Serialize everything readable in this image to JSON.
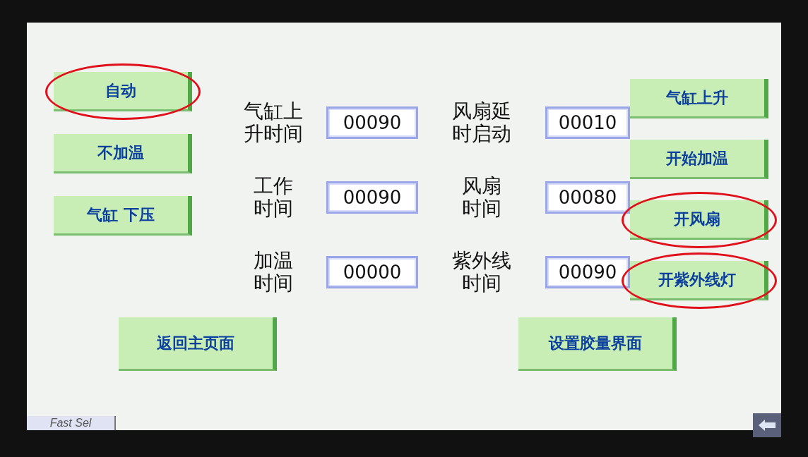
{
  "left_buttons": [
    {
      "label": "自动",
      "circled": true
    },
    {
      "label": "不加温",
      "circled": false
    },
    {
      "label": "气缸 下压",
      "circled": false
    }
  ],
  "fields": [
    {
      "label": "气缸上升时间",
      "value": "00090"
    },
    {
      "label": "风扇延时启动",
      "value": "00010"
    },
    {
      "label": "工作时间",
      "value": "00090"
    },
    {
      "label": "风扇时间",
      "value": "00080"
    },
    {
      "label": "加温时间",
      "value": "00000"
    },
    {
      "label": "紫外线时间",
      "value": "00090"
    }
  ],
  "right_buttons": [
    {
      "label": "气缸上升",
      "circled": false
    },
    {
      "label": "开始加温",
      "circled": false
    },
    {
      "label": "开风扇",
      "circled": true
    },
    {
      "label": "开紫外线灯",
      "circled": true
    }
  ],
  "bottom_buttons": [
    {
      "label": "返回主页面",
      "circled": false
    },
    {
      "label": "设置胶量界面",
      "circled": false
    }
  ],
  "fast_sel": "Fast Sel"
}
